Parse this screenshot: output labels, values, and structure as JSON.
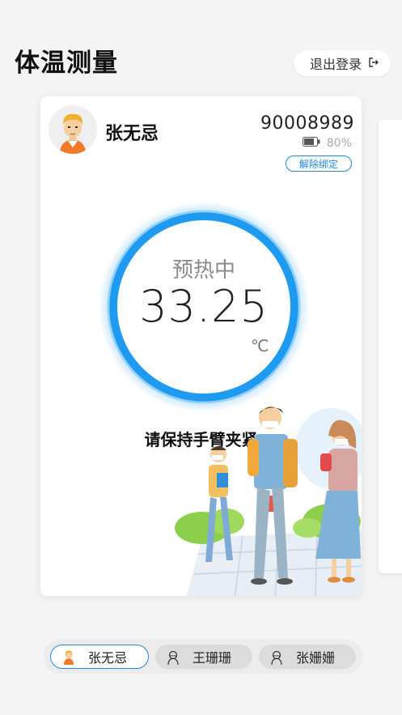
{
  "header": {
    "title": "体温测量",
    "logout_label": "退出登录",
    "logout_icon": "logout-icon"
  },
  "card": {
    "name": "张无忌",
    "avatar_icon": "boy-avatar",
    "device_id": "90008989",
    "battery_icon": "battery-icon",
    "battery_text": "80%",
    "battery_level": 0.8,
    "unbind_label": "解除绑定",
    "status_text": "预热中",
    "temperature": "33.25",
    "unit": "℃",
    "instruction": "请保持手臂夹紧",
    "accent_color": "#1e9bf0"
  },
  "tabs": [
    {
      "label": "张无忌",
      "icon": "boy-avatar-icon",
      "active": true
    },
    {
      "label": "王珊珊",
      "icon": "person-masked-icon",
      "active": false
    },
    {
      "label": "张姗姗",
      "icon": "person-masked-icon",
      "active": false
    }
  ]
}
